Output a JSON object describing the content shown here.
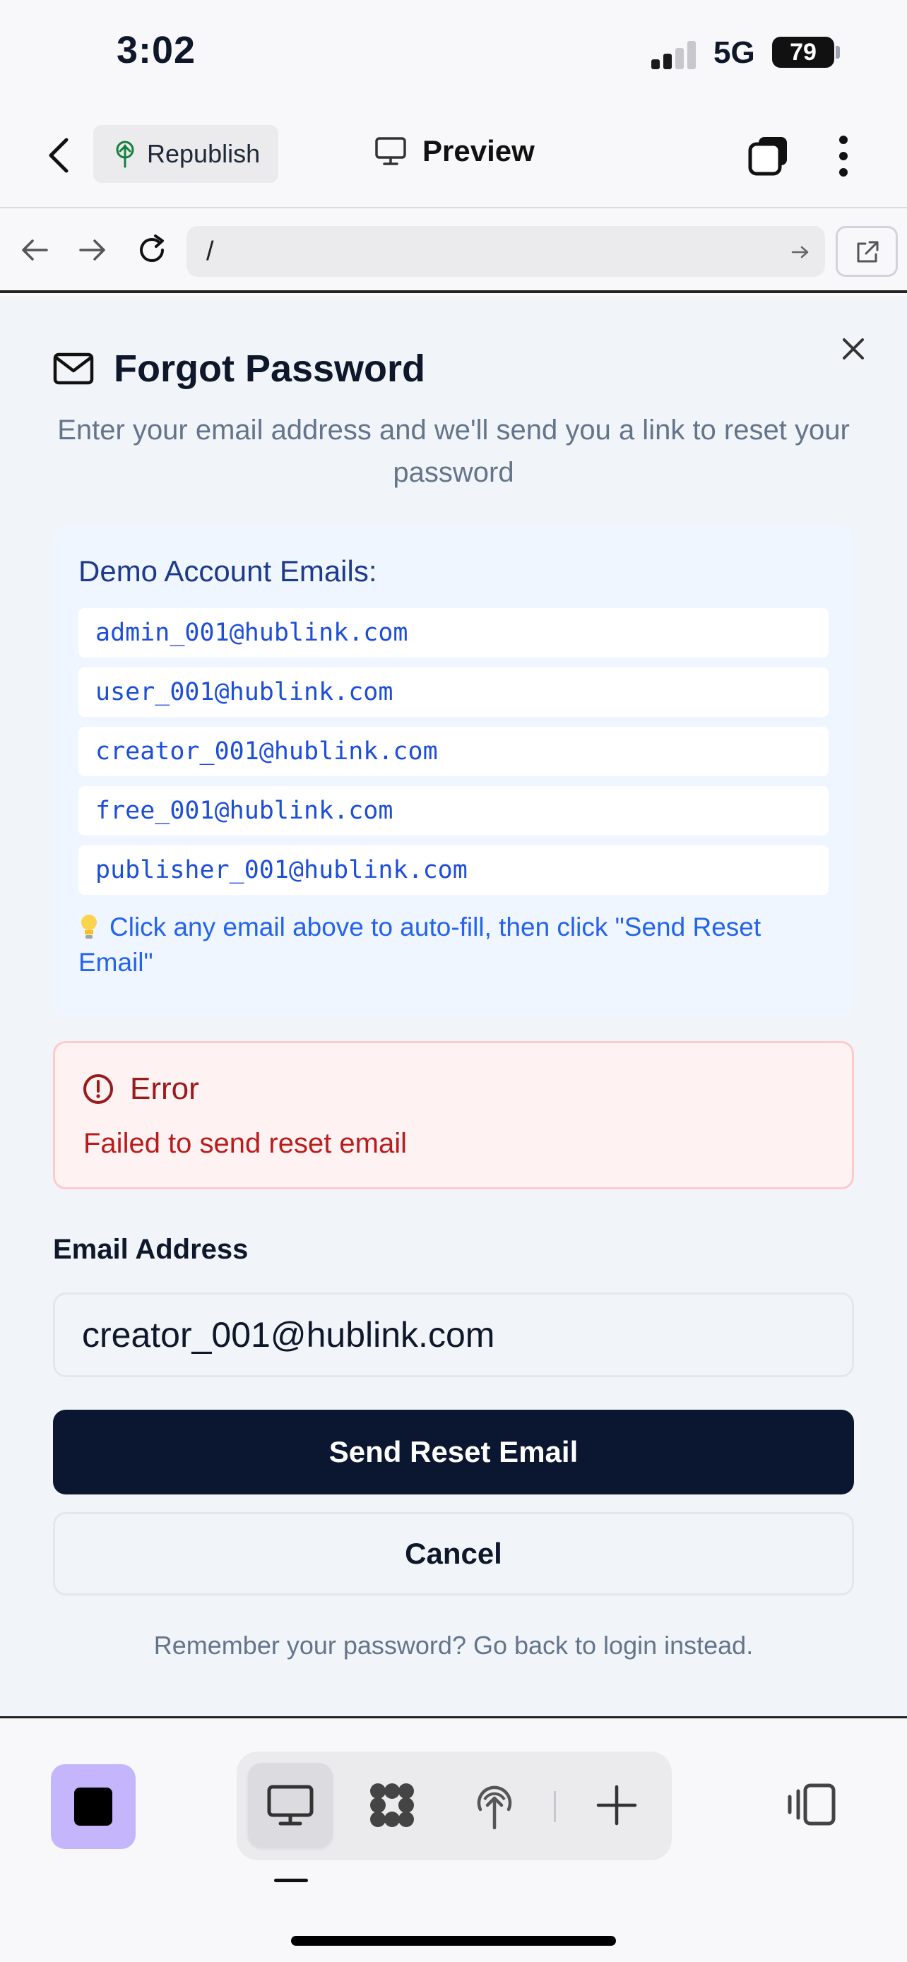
{
  "status_bar": {
    "time": "3:02",
    "network": "5G",
    "battery": "79"
  },
  "header": {
    "republish_label": "Republish",
    "preview_label": "Preview"
  },
  "browser": {
    "url": "/"
  },
  "dialog": {
    "title": "Forgot Password",
    "description": "Enter your email address and we'll send you a link to reset your password",
    "demo": {
      "title": "Demo Account Emails:",
      "emails": [
        "admin_001@hublink.com",
        "user_001@hublink.com",
        "creator_001@hublink.com",
        "free_001@hublink.com",
        "publisher_001@hublink.com"
      ],
      "hint": "Click any email above to auto-fill, then click \"Send Reset Email\""
    },
    "error": {
      "title": "Error",
      "message": "Failed to send reset email"
    },
    "email_label": "Email Address",
    "email_value": "creator_001@hublink.com",
    "send_label": "Send Reset Email",
    "cancel_label": "Cancel",
    "footer_text": "Remember your password? Go back to login instead."
  },
  "colors": {
    "primary_button": "#0b1630",
    "accent_purple": "#c4b5fd",
    "error_red": "#b91c1c",
    "link_blue": "#1d4ed8"
  }
}
